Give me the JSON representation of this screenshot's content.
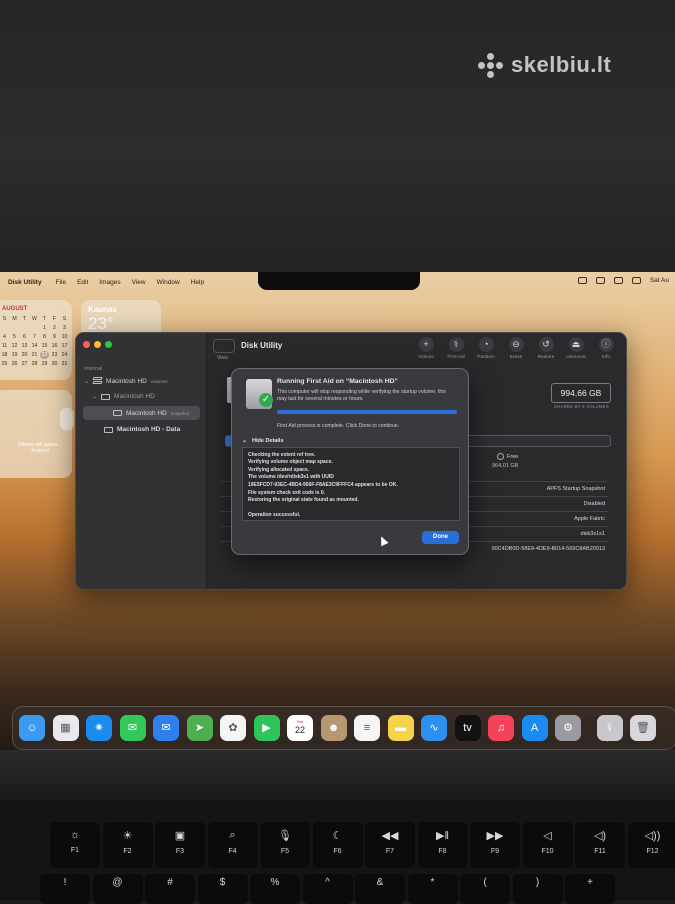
{
  "watermark": {
    "text": "skelbiu.lt"
  },
  "menubar": {
    "app_name": "Disk Utility",
    "items": [
      "File",
      "Edit",
      "Images",
      "View",
      "Window",
      "Help"
    ],
    "right_text": "Sat Au"
  },
  "widgets": {
    "calendar": {
      "month": "AUGUST",
      "weekdays": [
        "S",
        "M",
        "T",
        "W",
        "T",
        "F",
        "S"
      ],
      "days": [
        "",
        "",
        "",
        "",
        "1",
        "2",
        "3",
        "4",
        "5",
        "6",
        "7",
        "8",
        "9",
        "10",
        "11",
        "12",
        "13",
        "14",
        "15",
        "16",
        "17",
        "18",
        "19",
        "20",
        "21",
        "22",
        "23",
        "24",
        "25",
        "26",
        "27",
        "28",
        "29",
        "30",
        "31"
      ],
      "today": "22"
    },
    "weather": {
      "city": "Kaunas",
      "temp": "23°"
    },
    "photos": {
      "message": "Photos will appea... finished"
    }
  },
  "disk_utility": {
    "title": "Disk Utility",
    "view_label": "View",
    "sidebar": {
      "section": "Internal",
      "items": [
        {
          "label": "Macintosh HD",
          "sub": "volumes"
        },
        {
          "label": "Macintosh HD",
          "sub": ""
        },
        {
          "label": "Macintosh HD",
          "sub": "snapshot"
        },
        {
          "label": "Macintosh HD - Data",
          "sub": ""
        }
      ]
    },
    "toolbar": [
      {
        "label": "Volume",
        "icon": "+"
      },
      {
        "label": "First Aid",
        "icon": "⚕"
      },
      {
        "label": "Partition",
        "icon": "◔"
      },
      {
        "label": "Erase",
        "icon": "⊖"
      },
      {
        "label": "Restore",
        "icon": "↺"
      },
      {
        "label": "Unmount",
        "icon": "⏏"
      },
      {
        "label": "Info",
        "icon": "ⓘ"
      }
    ],
    "capacity": "994,66 GB",
    "shared_label": "SHARED BY 5 VOLUMES",
    "free_label": "Free",
    "free_value": "964,01 GB",
    "info_rows": [
      {
        "key": "",
        "value": "APFS Startup Snapshot"
      },
      {
        "key": "",
        "value": "Disabled"
      },
      {
        "key": "",
        "value": "Apple Fabric"
      },
      {
        "key": "",
        "value": "disk3s1s1"
      },
      {
        "key": "",
        "value": "90C4DB0D-58E9-4DE9-B014-569C8AB20013"
      }
    ]
  },
  "first_aid": {
    "title": "Running First Aid on “Macintosh HD”",
    "description": "This computer will stop responding while verifying the startup volume; this may last for several minutes or hours.",
    "progress": 1.0,
    "status": "First Aid process is complete. Click Done to continue.",
    "hide_details": "Hide Details",
    "log": [
      "Checking the extent ref tree.",
      "Verifying volume object map space.",
      "Verifying allocated space.",
      "The volume /dev/rdisk3s1 with UUID",
      "19E5FCD7-93EC-4BD4-956F-F8AE3C9FFFC4 appears to be OK.",
      "File system check exit code is 0.",
      "Restoring the original state found as mounted.",
      "",
      "Operation successful."
    ],
    "done_label": "Done"
  },
  "dock": {
    "apps": [
      {
        "name": "finder-icon",
        "glyph": "☺",
        "color": "#3a9af0"
      },
      {
        "name": "launchpad-icon",
        "glyph": "▦",
        "color": "#e8e8ee"
      },
      {
        "name": "safari-icon",
        "glyph": "✷",
        "color": "#1a8cf0"
      },
      {
        "name": "messages-icon",
        "glyph": "✉",
        "color": "#34c759"
      },
      {
        "name": "mail-icon",
        "glyph": "✉",
        "color": "#2f80ed"
      },
      {
        "name": "maps-icon",
        "glyph": "➤",
        "color": "#4cb050"
      },
      {
        "name": "photos-icon",
        "glyph": "✿",
        "color": "#f5f5f5"
      },
      {
        "name": "facetime-icon",
        "glyph": "▶",
        "color": "#2ec45a"
      },
      {
        "name": "calendar-icon",
        "glyph": "",
        "color": "#ffffff"
      },
      {
        "name": "contacts-icon",
        "glyph": "☻",
        "color": "#b89870"
      },
      {
        "name": "reminders-icon",
        "glyph": "≡",
        "color": "#f5f5f5"
      },
      {
        "name": "notes-icon",
        "glyph": "▬",
        "color": "#f5d34a"
      },
      {
        "name": "freeform-icon",
        "glyph": "∿",
        "color": "#2d8ff0"
      },
      {
        "name": "tv-icon",
        "glyph": "tv",
        "color": "#111111"
      },
      {
        "name": "music-icon",
        "glyph": "♫",
        "color": "#f5425a"
      },
      {
        "name": "appstore-icon",
        "glyph": "A",
        "color": "#1a8cf0"
      },
      {
        "name": "settings-icon",
        "glyph": "⚙",
        "color": "#9a9aa2"
      },
      {
        "name": "diskutility-icon",
        "glyph": "⚕",
        "color": "#c8c8cc"
      },
      {
        "name": "trash-icon",
        "glyph": "🗑",
        "color": "#d8d8dc"
      }
    ],
    "calendar_month": "Sat",
    "calendar_day": "22"
  },
  "keyboard": {
    "fkeys": [
      {
        "glyph": "☼",
        "label": "F1"
      },
      {
        "glyph": "☀",
        "label": "F2"
      },
      {
        "glyph": "▣",
        "label": "F3"
      },
      {
        "glyph": "⌕",
        "label": "F4"
      },
      {
        "glyph": "🎙",
        "label": "F5"
      },
      {
        "glyph": "☾",
        "label": "F6"
      },
      {
        "glyph": "◀◀",
        "label": "F7"
      },
      {
        "glyph": "▶‖",
        "label": "F8"
      },
      {
        "glyph": "▶▶",
        "label": "F9"
      },
      {
        "glyph": "◁",
        "label": "F10"
      },
      {
        "glyph": "◁)",
        "label": "F11"
      },
      {
        "glyph": "◁))",
        "label": "F12"
      }
    ],
    "number_row": [
      "!",
      "@",
      "#",
      "$",
      "%",
      "^",
      "&",
      "*",
      "(",
      ")",
      "+"
    ]
  }
}
